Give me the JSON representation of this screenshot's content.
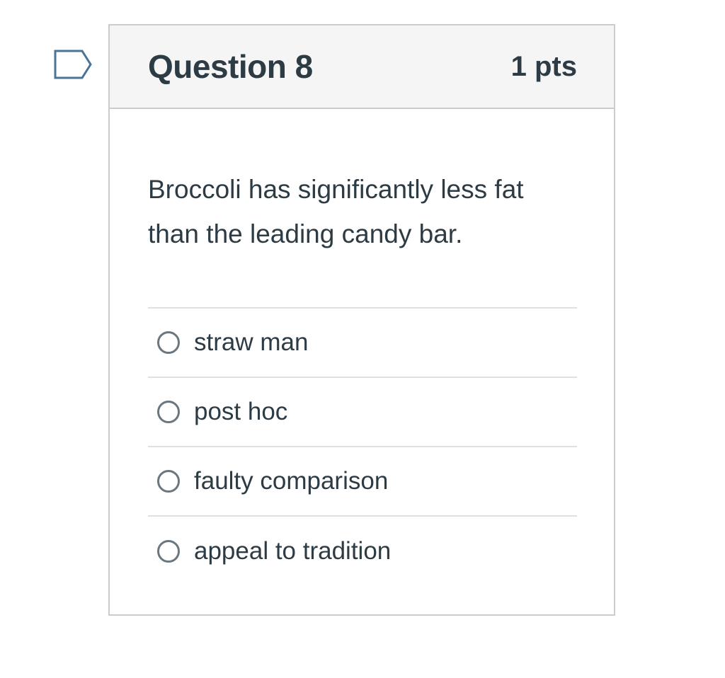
{
  "question": {
    "title": "Question 8",
    "points": "1 pts",
    "flag_icon": "flag-outline-icon",
    "text": "Broccoli has significantly less fat than the leading candy bar.",
    "options": [
      {
        "label": "straw man",
        "selected": false
      },
      {
        "label": "post hoc",
        "selected": false
      },
      {
        "label": "faulty comparison",
        "selected": false
      },
      {
        "label": "appeal to tradition",
        "selected": false
      }
    ]
  },
  "colors": {
    "text": "#2d3b45",
    "header_bg": "#f5f5f5",
    "border": "#c7cdd1",
    "divider": "#dde1e4",
    "flag": "#4a7396"
  }
}
